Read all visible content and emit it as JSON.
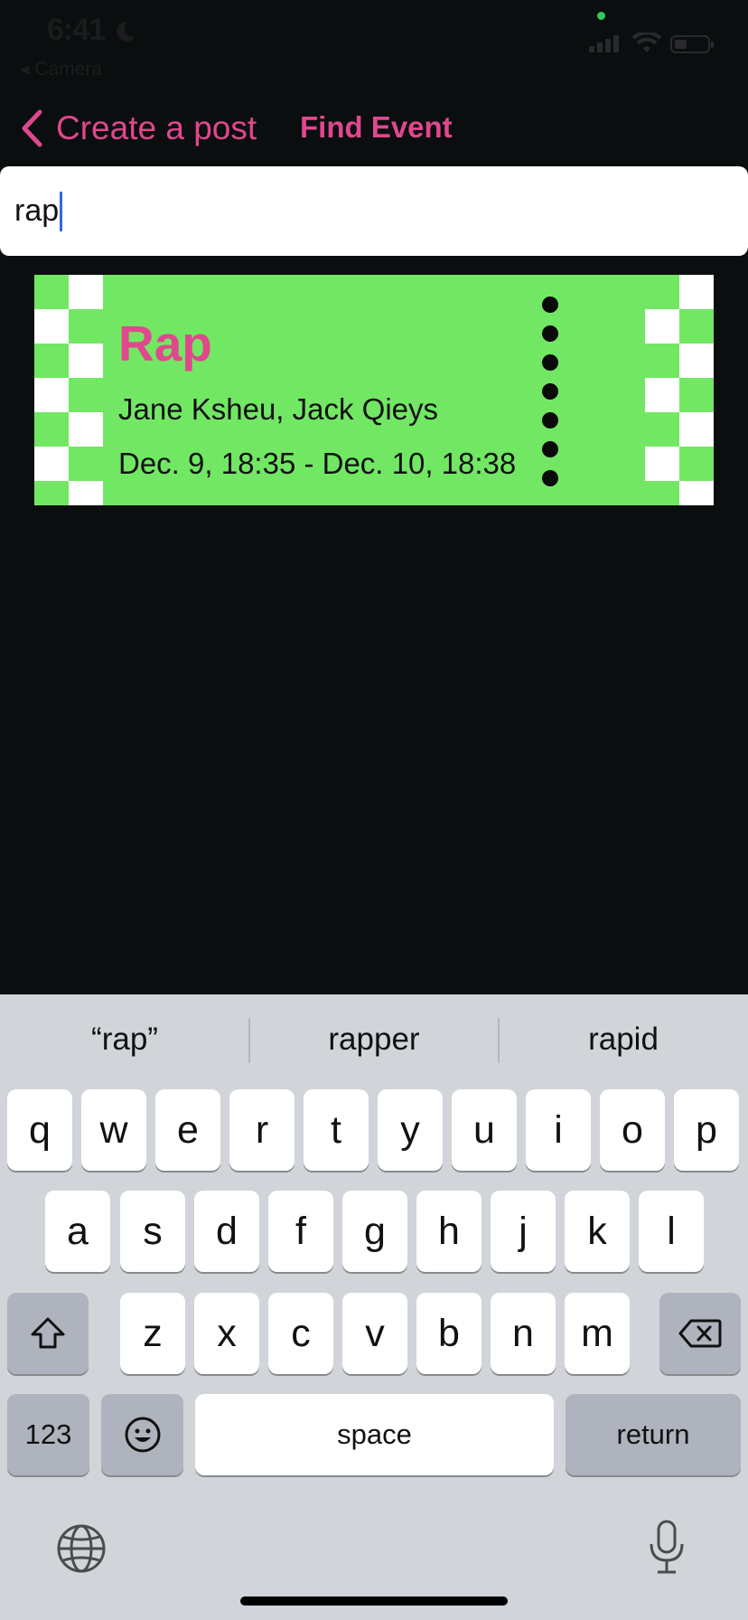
{
  "status": {
    "time": "6:41",
    "back_app": "◂ Camera"
  },
  "nav": {
    "back_label": "Create a post",
    "title": "Find Event"
  },
  "search": {
    "value": "rap"
  },
  "event": {
    "title": "Rap",
    "artists": "Jane Ksheu, Jack Qieys",
    "dates": "Dec. 9, 18:35 - Dec. 10, 18:38"
  },
  "keyboard": {
    "suggestions": [
      "“rap”",
      "rapper",
      "rapid"
    ],
    "row1": [
      "q",
      "w",
      "e",
      "r",
      "t",
      "y",
      "u",
      "i",
      "o",
      "p"
    ],
    "row2": [
      "a",
      "s",
      "d",
      "f",
      "g",
      "h",
      "j",
      "k",
      "l"
    ],
    "row3": [
      "z",
      "x",
      "c",
      "v",
      "b",
      "n",
      "m"
    ],
    "numbers_label": "123",
    "space_label": "space",
    "return_label": "return"
  },
  "colors": {
    "accent": "#e0478e",
    "ticket_green": "#72e764",
    "background": "#0a0e0e"
  }
}
